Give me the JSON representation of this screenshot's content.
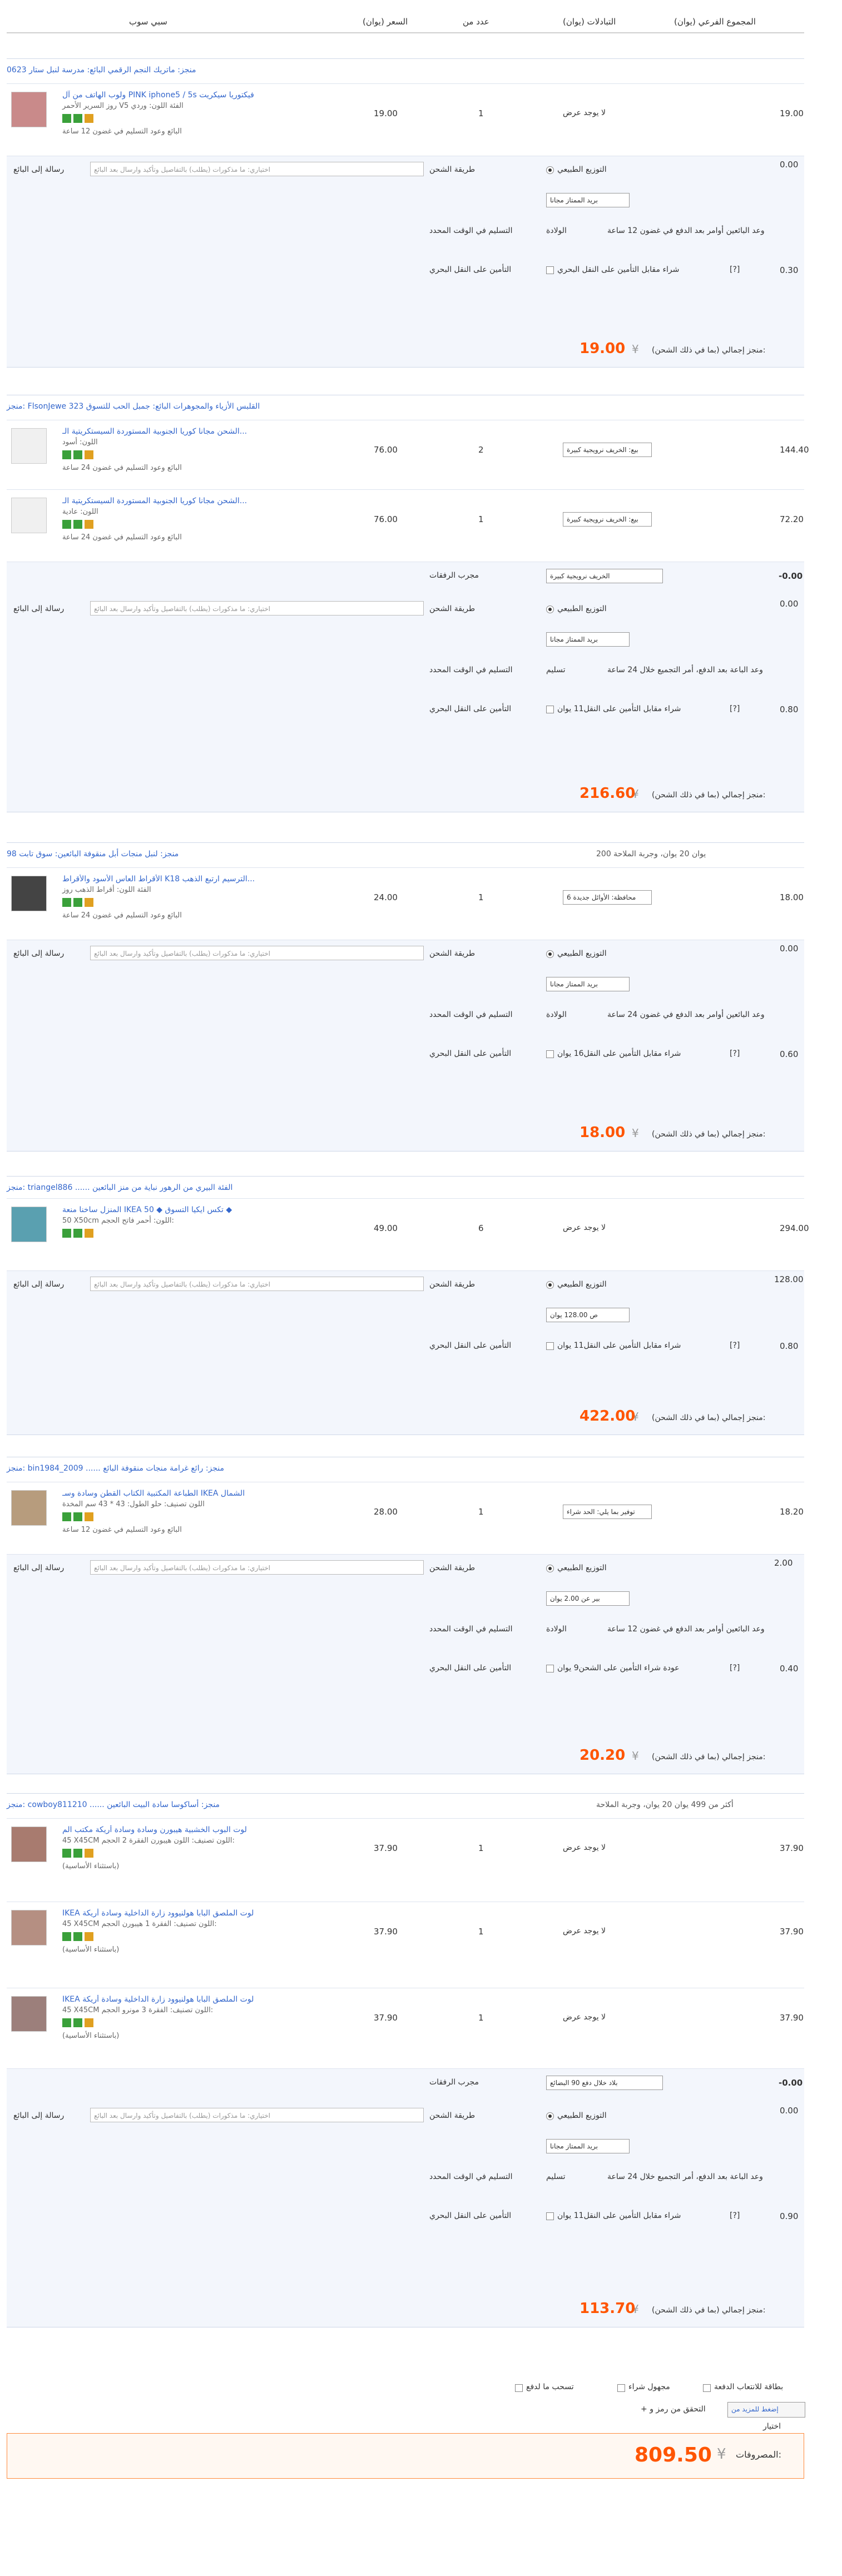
{
  "header": {
    "subtotal": "(المجموع الفرعي (يوان",
    "status": "(التبادلات (يوان",
    "qty": "عدد من",
    "price": "(السعر (يوان",
    "product": "سبي سوب"
  },
  "stores": [
    {
      "title": "منجز: ماتريك النجم الرقمي البائع: مدرسة لنبل ستار 0623"
    },
    {
      "title": "منجز: FlsonJewe القلبس الأزياء والمجوهرات البائع: جمبل الحب للتسوق 323"
    },
    {
      "title": "منجز: لنبل منجات أبل منقوفة البائعين: سوق تابت 98",
      "note": "يوان 20 يوان، وجربة الملاحة 200"
    },
    {
      "title": "منجز: triangel886 ...... الفئة البيري من الرهور نباية من منز البائعين",
      "note": ""
    },
    {
      "title": "منجز: bin1984_2009 ...... منجز: رائع غرامة منجات منقوفة البائع",
      "note": ""
    },
    {
      "title": "منجز: cowboy811210 ...... منجز: أساكوسا سادة البيت البائعين",
      "note": "أكثر من 499 يوان 20 يوان، وجربة الملاحة"
    }
  ],
  "items": [
    {
      "title": "ولوب الهاتف من آل PINK iphone5 / 5s فيكتوريا سيكريت",
      "sub1": "روز السرير الأحمر V5 الفئة اللون: وردي",
      "sub2": "البائع وعود التسليم في غضون 12 ساعة",
      "price": "19.00",
      "qty": "1",
      "status": "لا يوجد عرض",
      "subtotal": "19.00"
    },
    {
      "title": "الشحن مجانا كوريا الجنوبية المستوردة السيستكريتية الـ...",
      "sub1": "اللون: أسود",
      "sub2": "البائع وعود التسليم في غضون 24 ساعة",
      "price": "76.00",
      "qty": "2",
      "status": "بيع: الخريف نرويجية كبيرة",
      "subtotal": "144.40"
    },
    {
      "title": "الشحن مجانا كوريا الجنوبية المستوردة السيستكريتية الـ...",
      "sub1": "اللون: عادية",
      "sub2": "البائع وعود التسليم في غضون 24 ساعة",
      "price": "76.00",
      "qty": "1",
      "status": "بيع: الخريف نرويجية كبيرة",
      "subtotal": "72.20"
    },
    {
      "title": "الأقراط العاس الأسود والأقراط Kالترسيم ارتبع الذهب 18...",
      "sub1": "الفئة اللون: أقراط الذهب روز",
      "sub2": "البائع وعود التسليم في غضون 24 ساعة",
      "price": "24.00",
      "qty": "1",
      "status": "محافظة: الأوائل جديدة 6",
      "subtotal": "18.00"
    },
    {
      "title": "المنزل ساخنا منعة IKEA 50 ◆ تكس ايكيا التسوق ◆",
      "sub1": "50 X50cm اللون: أحمر فاتح الحجم:",
      "sub2": "",
      "price": "49.00",
      "qty": "6",
      "status": "لا يوجد عرض",
      "subtotal": "294.00"
    },
    {
      "title": "الطباعة المكتبية الكتاب القطن وسادة وسـ IKEA الشمال",
      "sub1": "اللون تصنيف: حلو  الطول: 43 * 43 سم المخدة",
      "sub2": "البائع وعود التسليم في غضون 12 ساعة",
      "price": "28.00",
      "qty": "1",
      "status": "توفير بما يلي: الحد شراء",
      "subtotal": "18.20"
    },
    {
      "title": "لوت البوب الخشبية هيبورن وسادة وسادة أريكة مكتب الم",
      "sub1": "45 X45CM اللون تصنيف: اللون هيبورن الفقرة 2 الحجم:",
      "sub2": "(باستثناء الأساسية)",
      "price": "37.90",
      "qty": "1",
      "status": "لا يوجد عرض",
      "subtotal": "37.90"
    },
    {
      "title": "IKEA لوت الملصق البابا هولنيوود زارة الداخلية وسادة أريكة",
      "sub1": "45 X45CM اللون تصنيف: الفقرة 1 هيبورن الحجم:",
      "sub2": "(باستثناء الأساسية)",
      "price": "37.90",
      "qty": "1",
      "status": "لا يوجد عرض",
      "subtotal": "37.90"
    },
    {
      "title": "IKEA لوت الملصق البابا هولنيوود زارة الداخلية وسادة أريكة",
      "sub1": "45 X45CM اللون تصنيف: الفقرة 3 مونرو الحجم:",
      "sub2": "(باستثناء الأساسية)",
      "price": "37.90",
      "qty": "1",
      "status": "لا يوجد عرض",
      "subtotal": "37.90"
    }
  ],
  "common": {
    "message_label": "رسالة إلى البائع",
    "message_placeholder": "اختياري: ما مذكورات (يطلب) بالتفاصيل وتأكيد وارسال بعد البائع",
    "ship_method": "طريقة الشحن",
    "natural": "التوزيع الطبيعي",
    "free_shipping": "بريد الممتاز مجانا",
    "delivery_label": "التسليم في الوقت المحدد",
    "insurance_label": "التأمين على النقل البحري",
    "store_total": "منجز إجمالي (بما في ذلك الشحن):",
    "offers": "مجرب الرفقات",
    "yen": "¥",
    "zero": "0.00",
    "help": "[?]"
  },
  "ship": [
    {
      "delivery": "وعد البائعين أوامر بعد الدفع في غضون 12 ساعة",
      "delivery_link": "الولادة",
      "insurance": "شراء مقابل التأمين على النقل البحري",
      "ins_fee": "0.30",
      "total": "19.00"
    },
    {
      "offer_select": "الخريف نرويجية كبيرة",
      "offer_value": "-0.00",
      "delivery": "وعد الباعة بعد الدفع، أمر التجميع خلال 24 ساعة",
      "delivery_link": "تسليم",
      "insurance": "شراء مقابل التأمين على النقل11 يوان",
      "ins_fee": "0.80",
      "total": "216.60"
    },
    {
      "delivery": "وعد البائعين أوامر بعد الدفع في غضون 24 ساعة",
      "delivery_link": "الولادة",
      "insurance": "شراء مقابل التأمين على النقل16 يوان",
      "ins_fee": "0.60",
      "total": "18.00"
    },
    {
      "ship_select": "ص 128.00 يوان",
      "ship_fee": "128.00",
      "insurance": "شراء مقابل التأمين على النقل11 يوان",
      "ins_fee": "0.80",
      "total": "422.00"
    },
    {
      "ship_select": "بير عن 2.00 يوان",
      "ship_fee": "2.00",
      "delivery": "وعد البائعين أوامر بعد الدفع في غضون 12 ساعة",
      "delivery_link": "الولادة",
      "insurance": "عودة شراء التأمين على الشحن9 يوان",
      "ins_fee": "0.40",
      "total": "20.20"
    },
    {
      "offer_select": "بلاد خلال دفع 90 البضائع",
      "offer_value": "-0.00",
      "delivery": "وعد الباعة بعد الدفع، أمر التجميع خلال 24 ساعة",
      "delivery_link": "تسليم",
      "insurance": "شراء مقابل التأمين على النقل11 يوان",
      "ins_fee": "0.90",
      "total": "113.70"
    }
  ],
  "footer": {
    "opt1": "بطاقة للانتعاب الدفعة",
    "opt2": "مجهول شراء",
    "opt3": "تسحب ما لدفع",
    "btn": "إضغط للمزيد من",
    "promo": "+ التحقق من رمز و",
    "choose": "اختيار",
    "grand_label": "المصروفات:",
    "grand_total": "809.50",
    "yen": "¥"
  }
}
